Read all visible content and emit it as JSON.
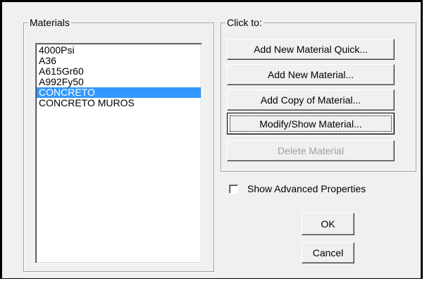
{
  "materials": {
    "caption": "Materials",
    "items": [
      "4000Psi",
      "A36",
      "A615Gr60",
      "A992Fy50",
      "CONCRETO",
      "CONCRETO MUROS"
    ],
    "selected": "CONCRETO"
  },
  "actions": {
    "caption": "Click to:",
    "add_quick": "Add New Material Quick...",
    "add_new": "Add New Material...",
    "add_copy": "Add Copy of Material...",
    "modify_show": "Modify/Show Material...",
    "delete": "Delete Material"
  },
  "options": {
    "show_advanced_label": "Show Advanced Properties",
    "show_advanced_checked": false
  },
  "buttons": {
    "ok": "OK",
    "cancel": "Cancel"
  },
  "colors": {
    "selection": "#3399ff",
    "dialog_face": "#f0f0f0",
    "disabled_text": "#a0a0a0"
  }
}
